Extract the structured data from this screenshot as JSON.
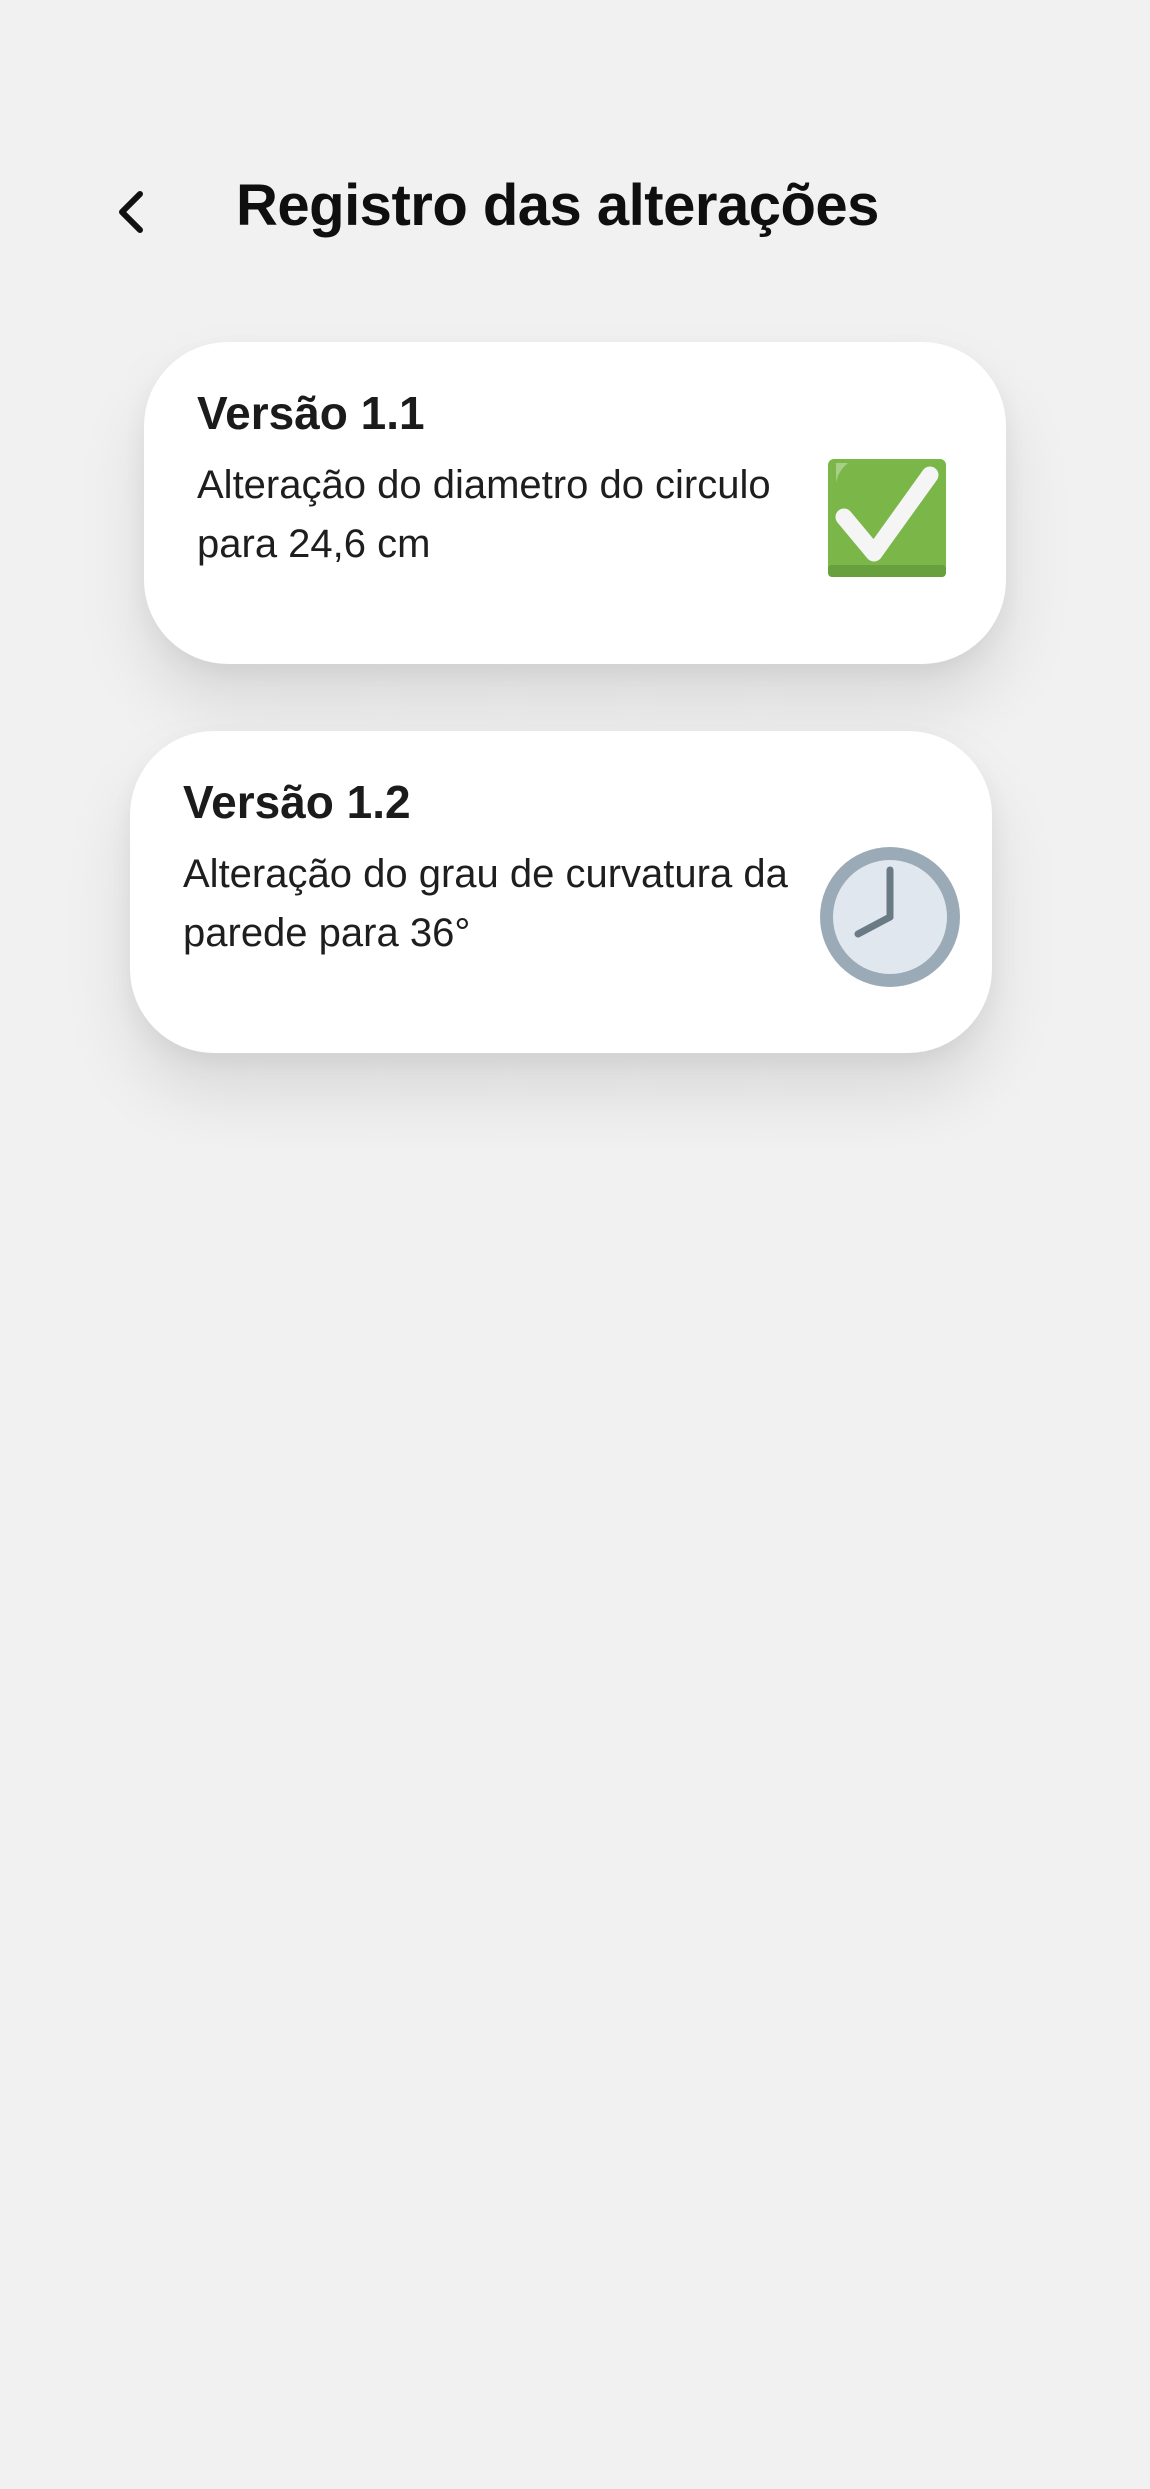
{
  "header": {
    "title": "Registro das alterações"
  },
  "changes": [
    {
      "version": "Versão 1.1",
      "description": "Alteração do diametro do circulo para 24,6 cm",
      "status_icon": "check-mark-icon",
      "status_color": "#7ab648"
    },
    {
      "version": "Versão 1.2",
      "description": "Alteração do grau de curvatura da parede para 36°",
      "status_icon": "clock-icon",
      "status_color": "#9aabb7"
    }
  ],
  "colors": {
    "background": "#f1f1f1",
    "card": "#ffffff",
    "check_green": "#7ab648",
    "clock_ring": "#9aabb7",
    "clock_face": "#e1e7ee"
  }
}
